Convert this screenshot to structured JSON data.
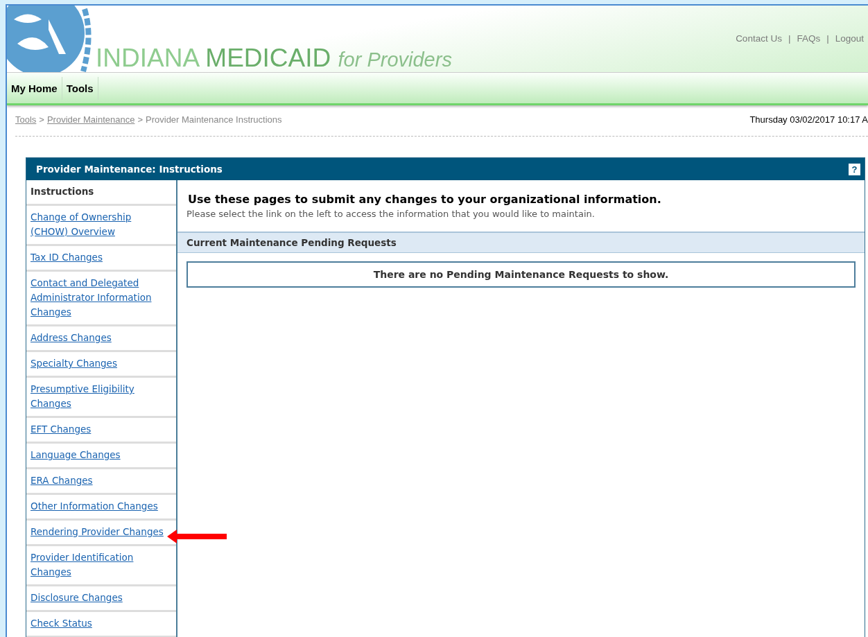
{
  "header": {
    "title_part_1": "INDIANA",
    "title_part_2": "MEDICAID",
    "title_part_3": "for Providers",
    "links": [
      "Contact Us",
      "FAQs",
      "Logout"
    ],
    "separators": [
      "|",
      "|"
    ]
  },
  "nav": [
    {
      "label": "My Home"
    },
    {
      "label": "Tools"
    }
  ],
  "breadcrumb": {
    "links": [
      "Tools",
      "Provider Maintenance"
    ],
    "separators": [
      ">",
      ">"
    ],
    "current": "Provider Maintenance Instructions"
  },
  "datetime": "Thursday 03/02/2017 10:17 A",
  "panel": {
    "title": "Provider Maintenance: Instructions",
    "help": "?",
    "sidebar": [
      {
        "kind": "heading",
        "label": "Instructions",
        "pointed": false
      },
      {
        "kind": "link",
        "label": "Change of Ownership (CHOW) Overview",
        "pointed": false
      },
      {
        "kind": "link",
        "label": "Tax ID Changes",
        "pointed": false
      },
      {
        "kind": "link",
        "label": "Contact and Delegated Administrator Information Changes",
        "pointed": false
      },
      {
        "kind": "link",
        "label": "Address Changes",
        "pointed": false
      },
      {
        "kind": "link",
        "label": "Specialty Changes",
        "pointed": false
      },
      {
        "kind": "link",
        "label": "Presumptive Eligibility Changes",
        "pointed": false
      },
      {
        "kind": "link",
        "label": "EFT Changes",
        "pointed": false
      },
      {
        "kind": "link",
        "label": "Language Changes",
        "pointed": false
      },
      {
        "kind": "link",
        "label": "ERA Changes",
        "pointed": false
      },
      {
        "kind": "link",
        "label": "Other Information Changes",
        "pointed": false
      },
      {
        "kind": "link",
        "label": "Rendering Provider Changes",
        "pointed": true
      },
      {
        "kind": "link",
        "label": "Provider Identification Changes",
        "pointed": false
      },
      {
        "kind": "link",
        "label": "Disclosure Changes",
        "pointed": false
      },
      {
        "kind": "link",
        "label": "Check Status",
        "pointed": false
      }
    ],
    "heading": "Use these pages to submit any changes to your organizational information.",
    "subtext": "Please select the link on the left to access the information that you would like to maintain.",
    "section_title": "Current Maintenance Pending Requests",
    "empty_message": "There are no Pending Maintenance Requests to show."
  }
}
